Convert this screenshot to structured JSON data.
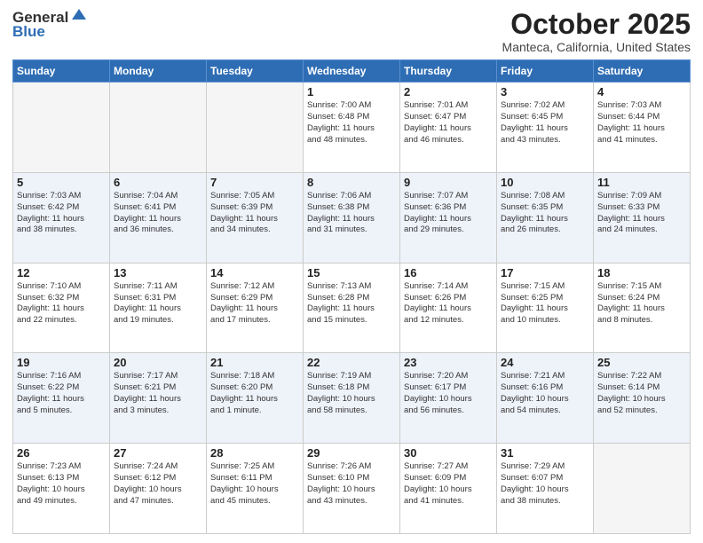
{
  "header": {
    "logo_general": "General",
    "logo_blue": "Blue",
    "month": "October 2025",
    "location": "Manteca, California, United States"
  },
  "days_of_week": [
    "Sunday",
    "Monday",
    "Tuesday",
    "Wednesday",
    "Thursday",
    "Friday",
    "Saturday"
  ],
  "weeks": [
    [
      {
        "day": "",
        "info": ""
      },
      {
        "day": "",
        "info": ""
      },
      {
        "day": "",
        "info": ""
      },
      {
        "day": "1",
        "info": "Sunrise: 7:00 AM\nSunset: 6:48 PM\nDaylight: 11 hours\nand 48 minutes."
      },
      {
        "day": "2",
        "info": "Sunrise: 7:01 AM\nSunset: 6:47 PM\nDaylight: 11 hours\nand 46 minutes."
      },
      {
        "day": "3",
        "info": "Sunrise: 7:02 AM\nSunset: 6:45 PM\nDaylight: 11 hours\nand 43 minutes."
      },
      {
        "day": "4",
        "info": "Sunrise: 7:03 AM\nSunset: 6:44 PM\nDaylight: 11 hours\nand 41 minutes."
      }
    ],
    [
      {
        "day": "5",
        "info": "Sunrise: 7:03 AM\nSunset: 6:42 PM\nDaylight: 11 hours\nand 38 minutes."
      },
      {
        "day": "6",
        "info": "Sunrise: 7:04 AM\nSunset: 6:41 PM\nDaylight: 11 hours\nand 36 minutes."
      },
      {
        "day": "7",
        "info": "Sunrise: 7:05 AM\nSunset: 6:39 PM\nDaylight: 11 hours\nand 34 minutes."
      },
      {
        "day": "8",
        "info": "Sunrise: 7:06 AM\nSunset: 6:38 PM\nDaylight: 11 hours\nand 31 minutes."
      },
      {
        "day": "9",
        "info": "Sunrise: 7:07 AM\nSunset: 6:36 PM\nDaylight: 11 hours\nand 29 minutes."
      },
      {
        "day": "10",
        "info": "Sunrise: 7:08 AM\nSunset: 6:35 PM\nDaylight: 11 hours\nand 26 minutes."
      },
      {
        "day": "11",
        "info": "Sunrise: 7:09 AM\nSunset: 6:33 PM\nDaylight: 11 hours\nand 24 minutes."
      }
    ],
    [
      {
        "day": "12",
        "info": "Sunrise: 7:10 AM\nSunset: 6:32 PM\nDaylight: 11 hours\nand 22 minutes."
      },
      {
        "day": "13",
        "info": "Sunrise: 7:11 AM\nSunset: 6:31 PM\nDaylight: 11 hours\nand 19 minutes."
      },
      {
        "day": "14",
        "info": "Sunrise: 7:12 AM\nSunset: 6:29 PM\nDaylight: 11 hours\nand 17 minutes."
      },
      {
        "day": "15",
        "info": "Sunrise: 7:13 AM\nSunset: 6:28 PM\nDaylight: 11 hours\nand 15 minutes."
      },
      {
        "day": "16",
        "info": "Sunrise: 7:14 AM\nSunset: 6:26 PM\nDaylight: 11 hours\nand 12 minutes."
      },
      {
        "day": "17",
        "info": "Sunrise: 7:15 AM\nSunset: 6:25 PM\nDaylight: 11 hours\nand 10 minutes."
      },
      {
        "day": "18",
        "info": "Sunrise: 7:15 AM\nSunset: 6:24 PM\nDaylight: 11 hours\nand 8 minutes."
      }
    ],
    [
      {
        "day": "19",
        "info": "Sunrise: 7:16 AM\nSunset: 6:22 PM\nDaylight: 11 hours\nand 5 minutes."
      },
      {
        "day": "20",
        "info": "Sunrise: 7:17 AM\nSunset: 6:21 PM\nDaylight: 11 hours\nand 3 minutes."
      },
      {
        "day": "21",
        "info": "Sunrise: 7:18 AM\nSunset: 6:20 PM\nDaylight: 11 hours\nand 1 minute."
      },
      {
        "day": "22",
        "info": "Sunrise: 7:19 AM\nSunset: 6:18 PM\nDaylight: 10 hours\nand 58 minutes."
      },
      {
        "day": "23",
        "info": "Sunrise: 7:20 AM\nSunset: 6:17 PM\nDaylight: 10 hours\nand 56 minutes."
      },
      {
        "day": "24",
        "info": "Sunrise: 7:21 AM\nSunset: 6:16 PM\nDaylight: 10 hours\nand 54 minutes."
      },
      {
        "day": "25",
        "info": "Sunrise: 7:22 AM\nSunset: 6:14 PM\nDaylight: 10 hours\nand 52 minutes."
      }
    ],
    [
      {
        "day": "26",
        "info": "Sunrise: 7:23 AM\nSunset: 6:13 PM\nDaylight: 10 hours\nand 49 minutes."
      },
      {
        "day": "27",
        "info": "Sunrise: 7:24 AM\nSunset: 6:12 PM\nDaylight: 10 hours\nand 47 minutes."
      },
      {
        "day": "28",
        "info": "Sunrise: 7:25 AM\nSunset: 6:11 PM\nDaylight: 10 hours\nand 45 minutes."
      },
      {
        "day": "29",
        "info": "Sunrise: 7:26 AM\nSunset: 6:10 PM\nDaylight: 10 hours\nand 43 minutes."
      },
      {
        "day": "30",
        "info": "Sunrise: 7:27 AM\nSunset: 6:09 PM\nDaylight: 10 hours\nand 41 minutes."
      },
      {
        "day": "31",
        "info": "Sunrise: 7:29 AM\nSunset: 6:07 PM\nDaylight: 10 hours\nand 38 minutes."
      },
      {
        "day": "",
        "info": ""
      }
    ]
  ]
}
